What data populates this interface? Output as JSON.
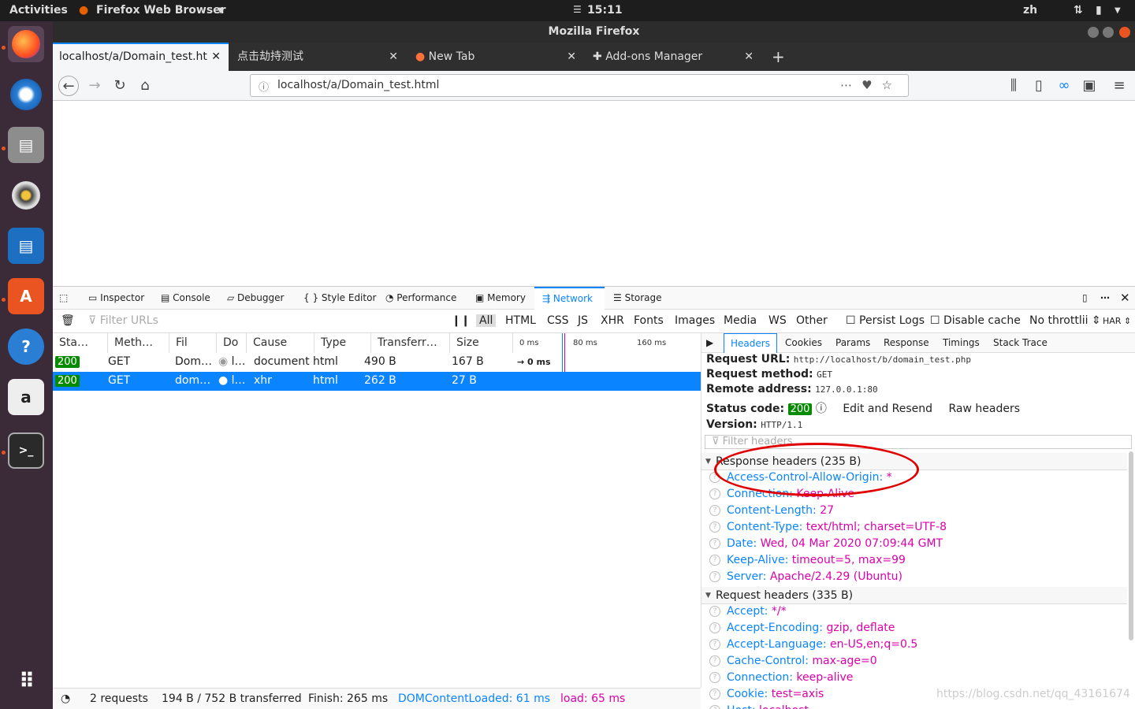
{
  "topbar": {
    "activities": "Activities",
    "app": "Firefox Web Browser",
    "clock": "15:11",
    "lang": "zh"
  },
  "window": {
    "title": "Mozilla Firefox"
  },
  "tabs": [
    {
      "label": "localhost/a/Domain_test.ht"
    },
    {
      "label": "点击劫持测试"
    },
    {
      "label": "New Tab"
    },
    {
      "label": "Add-ons Manager"
    }
  ],
  "url": "localhost/a/Domain_test.html",
  "devtools": {
    "tabs": [
      "Inspector",
      "Console",
      "Debugger",
      "Style Editor",
      "Performance",
      "Memory",
      "Network",
      "Storage"
    ],
    "filter_placeholder": "Filter URLs",
    "type_filters": [
      "All",
      "HTML",
      "CSS",
      "JS",
      "XHR",
      "Fonts",
      "Images",
      "Media",
      "WS",
      "Other"
    ],
    "persist_logs": "Persist Logs",
    "disable_cache": "Disable cache",
    "throttling": "No throttlii",
    "har": "HAR",
    "columns": [
      "Sta…",
      "Meth…",
      "Fil",
      "Do",
      "Cause",
      "Type",
      "Transferr…",
      "Size",
      "0 ms",
      "80 ms",
      "160 ms"
    ],
    "requests": [
      {
        "status": "200",
        "method": "GET",
        "file": "Dom…",
        "domain": "l…",
        "cause": "document",
        "type": "html",
        "transferred": "490 B",
        "size": "167 B",
        "timing": "→ 0 ms"
      },
      {
        "status": "200",
        "method": "GET",
        "file": "dom…",
        "domain": "l…",
        "cause": "xhr",
        "type": "html",
        "transferred": "262 B",
        "size": "27 B",
        "timing": ""
      }
    ],
    "detail_tabs": [
      "Headers",
      "Cookies",
      "Params",
      "Response",
      "Timings",
      "Stack Trace"
    ],
    "details": {
      "request_url_label": "Request URL:",
      "request_url": "http://localhost/b/domain_test.php",
      "request_method_label": "Request method:",
      "request_method": "GET",
      "remote_address_label": "Remote address:",
      "remote_address": "127.0.0.1:80",
      "status_code_label": "Status code:",
      "status_code": "200",
      "edit_resend": "Edit and Resend",
      "raw_headers": "Raw headers",
      "version_label": "Version:",
      "version": "HTTP/1.1",
      "filter_headers": "Filter headers",
      "response_headers_title": "Response headers (235 B)",
      "response_headers": [
        {
          "k": "Access-Control-Allow-Origin:",
          "v": "*"
        },
        {
          "k": "Connection:",
          "v": "Keep-Alive"
        },
        {
          "k": "Content-Length:",
          "v": "27"
        },
        {
          "k": "Content-Type:",
          "v": "text/html; charset=UTF-8"
        },
        {
          "k": "Date:",
          "v": "Wed, 04 Mar 2020 07:09:44 GMT"
        },
        {
          "k": "Keep-Alive:",
          "v": "timeout=5, max=99"
        },
        {
          "k": "Server:",
          "v": "Apache/2.4.29 (Ubuntu)"
        }
      ],
      "request_headers_title": "Request headers (335 B)",
      "request_headers": [
        {
          "k": "Accept:",
          "v": "*/*"
        },
        {
          "k": "Accept-Encoding:",
          "v": "gzip, deflate"
        },
        {
          "k": "Accept-Language:",
          "v": "en-US,en;q=0.5"
        },
        {
          "k": "Cache-Control:",
          "v": "max-age=0"
        },
        {
          "k": "Connection:",
          "v": "keep-alive"
        },
        {
          "k": "Cookie:",
          "v": "test=axis"
        },
        {
          "k": "Host:",
          "v": "localhost"
        }
      ]
    },
    "statusbar": {
      "requests": "2 requests",
      "transferred": "194 B / 752 B transferred",
      "finish": "Finish: 265 ms",
      "dom": "DOMContentLoaded: 61 ms",
      "load": "load: 65 ms"
    }
  },
  "watermark": "https://blog.csdn.net/qq_43161674",
  "colors": {
    "accent": "#0a84ff",
    "status_ok": "#058b00",
    "header_value": "#dd00a9",
    "annotation": "#e00000"
  }
}
